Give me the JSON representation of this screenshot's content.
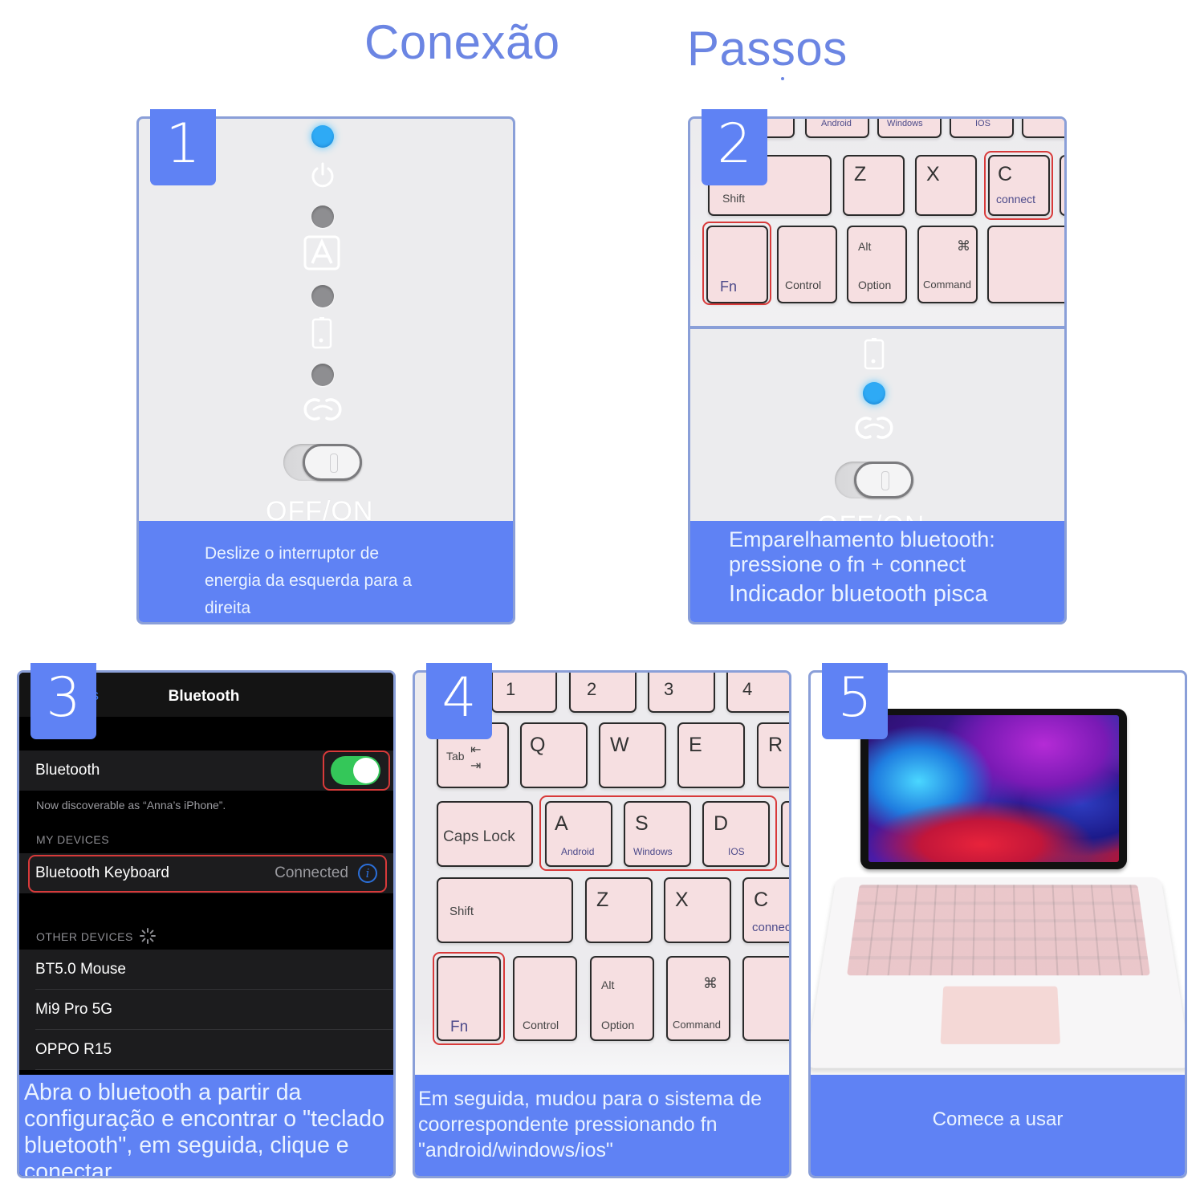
{
  "header": {
    "title_left": "Conexão",
    "title_right": "Passos"
  },
  "colors": {
    "accent_blue": "#5f82f4",
    "title_blue": "#6b85e3",
    "highlight_red": "#d83a3a",
    "led_blue": "#2eaaf5",
    "toggle_green": "#34c759"
  },
  "steps": [
    {
      "number": "1",
      "indicators": [
        "led-on",
        "power-icon",
        "led-off",
        "caps-lock-icon",
        "led-off",
        "battery-icon",
        "led-off",
        "bluetooth-link-icon"
      ],
      "switch_label": "OFF/ON",
      "caption": [
        "Deslize o interruptor de",
        "energia da esquerda para a",
        "direita"
      ]
    },
    {
      "number": "2",
      "keys_top": [
        "Android",
        "Windows",
        "IOS"
      ],
      "keys": {
        "z": "Z",
        "x": "X",
        "c": "C",
        "c_sub": "connect",
        "shift": "Shift",
        "fn": "Fn",
        "control": "Control",
        "alt": "Alt",
        "option": "Option",
        "cmd_symbol": "⌘",
        "command": "Command"
      },
      "switch_label": "OFF/ON",
      "caption": [
        "Emparelhamento bluetooth:",
        "pressione o fn + connect",
        "Indicador bluetooth pisca"
      ]
    },
    {
      "number": "3",
      "ios": {
        "back_label": "s",
        "nav_title": "Bluetooth",
        "toggle_label": "Bluetooth",
        "toggle_on": true,
        "discoverable": "Now discoverable as “Anna’s iPhone”.",
        "my_devices_header": "MY DEVICES",
        "my_devices": [
          {
            "name": "Bluetooth Keyboard",
            "status": "Connected"
          }
        ],
        "other_devices_header": "OTHER DEVICES",
        "other_devices": [
          "BT5.0 Mouse",
          "Mi9 Pro 5G",
          "OPPO R15"
        ]
      },
      "caption": [
        "Abra o bluetooth a partir da",
        "configuração e encontrar o \"teclado",
        "bluetooth\", em seguida, clique e",
        "conectar"
      ]
    },
    {
      "number": "4",
      "keys": {
        "num": [
          "1",
          "2",
          "3",
          "4"
        ],
        "tab": "Tab",
        "qwer": [
          "Q",
          "W",
          "E",
          "R"
        ],
        "caps": "Caps Lock",
        "a": "A",
        "a_sub": "Android",
        "s": "S",
        "s_sub": "Windows",
        "d": "D",
        "d_sub": "IOS",
        "shift": "Shift",
        "z": "Z",
        "x": "X",
        "c": "C",
        "c_sub": "connec",
        "fn": "Fn",
        "control": "Control",
        "alt": "Alt",
        "option": "Option",
        "cmd_symbol": "⌘",
        "command": "Command"
      },
      "caption": [
        "Em seguida, mudou para o sistema de",
        "coorrespondente pressionando fn",
        "\"android/windows/ios\""
      ]
    },
    {
      "number": "5",
      "caption": [
        "Comece a usar"
      ]
    }
  ]
}
